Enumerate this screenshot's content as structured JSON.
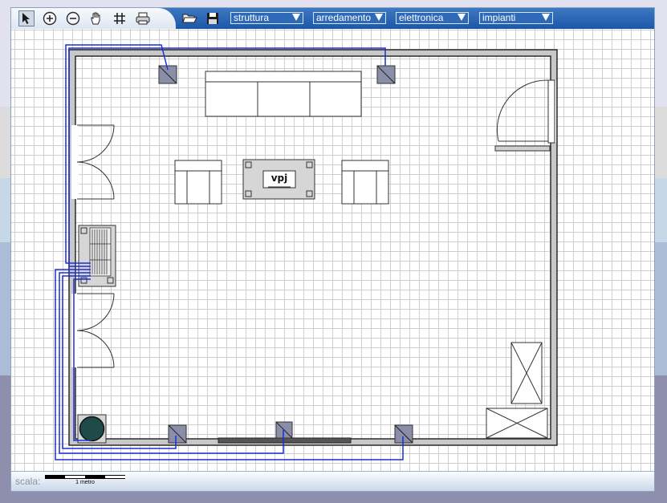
{
  "toolbar": {
    "tools": [
      "select-arrow-icon",
      "zoom-in-icon",
      "zoom-out-icon",
      "pan-hand-icon",
      "grid-icon",
      "print-icon",
      "open-folder-icon",
      "save-disk-icon"
    ],
    "menus": [
      {
        "label": "struttura"
      },
      {
        "label": "arredamento"
      },
      {
        "label": "elettronica"
      },
      {
        "label": "impianti"
      }
    ]
  },
  "plan": {
    "device_label": "vpj"
  },
  "status": {
    "scale_label": "scala:",
    "scale_text": "1 metro"
  },
  "colors": {
    "toolbar_blue": "#1d57a8",
    "wall_gray": "#c8c8c8",
    "wire_blue": "#1b2fd6",
    "outlet_gray": "#8a8ea8",
    "speaker_green": "#1f4a47"
  }
}
